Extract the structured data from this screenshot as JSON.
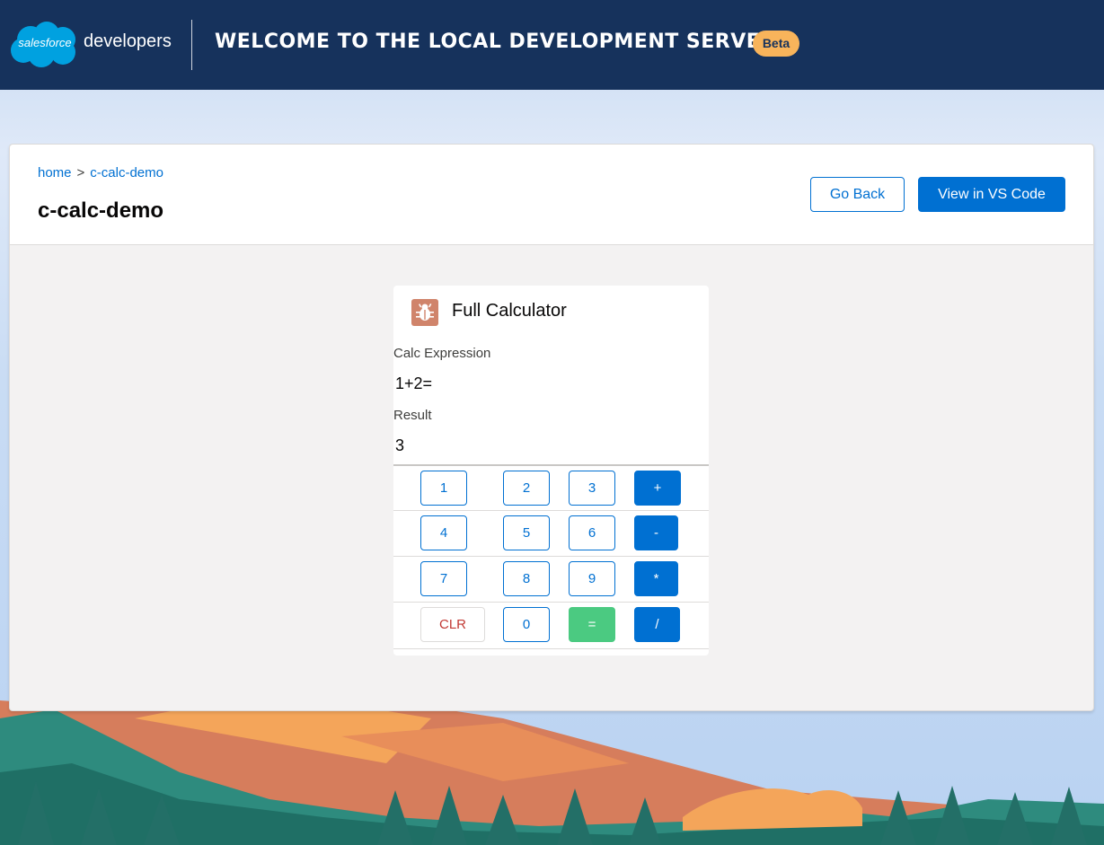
{
  "header": {
    "logo_text": "salesforce",
    "brand_text": "developers",
    "title": "Welcome to the Local Development Server",
    "badge": "Beta"
  },
  "breadcrumb": {
    "home": "home",
    "separator": ">",
    "current": "c-calc-demo"
  },
  "page_title": "c-calc-demo",
  "actions": {
    "go_back": "Go Back",
    "view_code": "View in VS Code"
  },
  "calculator": {
    "title": "Full Calculator",
    "icon": "bug-icon",
    "expression_label": "Calc Expression",
    "expression_value": "1+2=",
    "result_label": "Result",
    "result_value": "3",
    "rows": [
      [
        "1",
        "2",
        "3",
        "+"
      ],
      [
        "4",
        "5",
        "6",
        "-"
      ],
      [
        "7",
        "8",
        "9",
        "*"
      ],
      [
        "CLR",
        "0",
        "=",
        "/"
      ]
    ]
  },
  "colors": {
    "header_bg": "#16325c",
    "brand_blue": "#0070d2",
    "badge": "#f8b45b",
    "equals_green": "#4bca81",
    "clear_red": "#c23934"
  }
}
